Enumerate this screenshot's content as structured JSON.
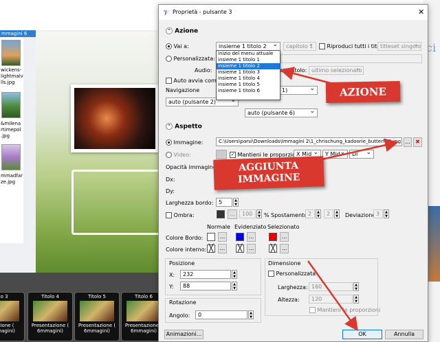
{
  "background": {
    "tab_label": "mmagini 6",
    "thumbs": [
      {
        "lines": [
          "wickens-",
          "lightmalv",
          "lls.jpg"
        ]
      },
      {
        "lines": [
          "&milena",
          "rtimepol",
          ".jpg"
        ]
      },
      {
        "lines": [
          "mmadfar",
          "ze.jpg"
        ]
      }
    ],
    "slides": [
      {
        "title": "olo 3",
        "line1": "ntazione (",
        "line2": "6mmagini)"
      },
      {
        "title": "Titolo 4",
        "line1": "Presentazione (",
        "line2": "6mmagini)"
      },
      {
        "title": "Titolo 5",
        "line1": "Presentazione (",
        "line2": "6mmagini)"
      },
      {
        "title": "Titolo 6",
        "line1": "Presentazione (",
        "line2": "6mmagini)"
      }
    ],
    "right_text": "ci"
  },
  "dialog": {
    "title": "Proprietà - pulsante 3",
    "close_glyph": "✕",
    "azione": {
      "header": "Azione",
      "vai_a_label": "Vai a:",
      "vai_a_value": "insieme 1 titolo 2",
      "capitolo_value": "capitolo 1",
      "riproduci_label": "Riproduci tutti i titoli",
      "titleset_value": "titleset singolo",
      "personalizzata_label": "Personalizzata:",
      "audio_label": "Audio:",
      "sottotitolo_label": "ottotitolo:",
      "sottotitolo_value": "ultimo selezionato",
      "auto_avvia_label": "Auto avvia comand",
      "navigazione_label": "Navigazione",
      "nav_value1": "1)",
      "nav_value2": "auto (pulsante 2)",
      "nav_value3": "auto (pulsante 6)",
      "dropdown_items": [
        "inizio del menu attuale",
        "insieme 1 titolo 1",
        "insieme 1 titolo 2",
        "insieme 1 titolo 3",
        "insieme 1 titolo 4",
        "insieme 1 titolo 5",
        "insieme 1 titolo 6"
      ],
      "dropdown_selected_index": 2
    },
    "aspetto": {
      "header": "Aspetto",
      "immagine_label": "Immagine:",
      "immagine_path": "C:\\Users\\parsi\\Downloads\\Immagini 2\\1_chrischung_kadoorie_butterfly1.jpg",
      "browse_label": "...",
      "clear_glyph": "✖",
      "video_label": "Video:",
      "mantieni_label": "Mantieni le proporzioni",
      "x_mid": "X Mid",
      "y_mid": "Y Mid",
      "di_partial": "Di",
      "opacita_label": "Opacità immagine:",
      "dx_label": "Dx:",
      "dy_label": "Dy:",
      "larghezza_bordo_label": "Larghezza bordo:",
      "larghezza_bordo_value": "5",
      "ombra_label": "Ombra:",
      "ombra_value": "100",
      "percent": "%",
      "spostamento_label": "Spostamento:",
      "spost_x": "2",
      "spost_y": "2",
      "deviazione_label": "Deviazione:",
      "deviazione_value": "3",
      "normale_label": "Normale",
      "evidenziato_label": "Evidenziato",
      "selezionato_label": "Selezionato",
      "colore_bordo_label": "Colore Bordo:",
      "colore_interno_label": "Colore interno:",
      "colors": {
        "normale": "#ffffff",
        "evidenziato": "#0000ee",
        "selezionato": "#ee0000"
      }
    },
    "posizione": {
      "header": "Posizione",
      "x_label": "X:",
      "x_value": "232",
      "y_label": "Y:",
      "y_value": "88"
    },
    "dimensione": {
      "header": "Dimensione",
      "personalizzata_label": "Personalizzata",
      "larghezza_label": "Larghezza:",
      "larghezza_value": "160",
      "altezza_label": "Altezza:",
      "altezza_value": "120",
      "mantieni_label": "Mantieni le proporzioni"
    },
    "rotazione": {
      "header": "Rotazione",
      "angolo_label": "Angolo:",
      "angolo_value": "0"
    },
    "buttons": {
      "animazioni": "Animazioni...",
      "ok": "OK",
      "annulla": "Annulla"
    }
  },
  "annotations": {
    "azione": "AZIONE",
    "aggiunta_line1": "AGGIUNTA",
    "aggiunta_line2": "IMMAGINE",
    "color": "#d8382d"
  }
}
